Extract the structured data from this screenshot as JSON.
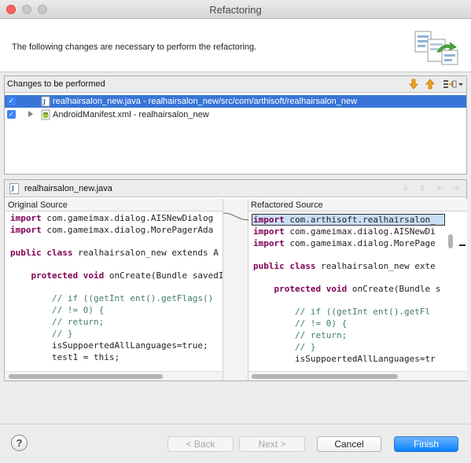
{
  "window": {
    "title": "Refactoring"
  },
  "header": {
    "message": "The following changes are necessary to perform the refactoring."
  },
  "changes_panel": {
    "title": "Changes to be performed",
    "items": [
      {
        "label": "realhairsalon_new.java - realhairsalon_new/src/com/arthisoft/realhairsalon_new",
        "checked": true,
        "selected": true,
        "expandable": false
      },
      {
        "label": "AndroidManifest.xml - realhairsalon_new",
        "checked": true,
        "selected": false,
        "expandable": true
      }
    ]
  },
  "compare_panel": {
    "title": "realhairsalon_new.java",
    "original_label": "Original Source",
    "refactored_label": "Refactored Source",
    "original_lines": [
      "import com.gameimax.dialog.AISNewDialog",
      "import com.gameimax.dialog.MorePagerAda",
      "",
      "public class realhairsalon_new extends A",
      "",
      "    protected void onCreate(Bundle savedI",
      "",
      "        // if ((getInt ent().getFlags()",
      "        // != 0) {",
      "        // return;",
      "        // }",
      "        isSuppoertedAllLanguages=true;",
      "        test1 = this;"
    ],
    "refactored_lines": [
      "import com.arthisoft.realhairsalon_",
      "import com.gameimax.dialog.AISNewDi",
      "import com.gameimax.dialog.MorePage",
      "",
      "public class realhairsalon_new exte",
      "",
      "    protected void onCreate(Bundle s",
      "",
      "        // if ((getInt ent().getFl",
      "        // != 0) {",
      "        // return;",
      "        // }",
      "        isSuppoertedAllLanguages=tr"
    ]
  },
  "buttons": {
    "help": "?",
    "back": "< Back",
    "next": "Next >",
    "cancel": "Cancel",
    "finish": "Finish"
  },
  "colors": {
    "selection": "#3875d7",
    "primary_button": "#0a80ff",
    "keyword": "#7f0055",
    "comment": "#3f7f5f"
  }
}
